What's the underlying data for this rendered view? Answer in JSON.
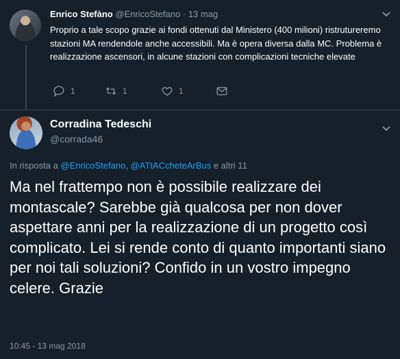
{
  "parent": {
    "display_name": "Enrico Stefàno",
    "handle": "@EnricoStefano",
    "separator": "·",
    "time": "13 mag",
    "text": "Proprio a tale scopo grazie ai fondi ottenuti dal Ministero (400 milioni) ristrutureremo stazioni MA rendendole anche accessibili. Ma è opera diversa dalla MC. Problema è realizzazione ascensori, in alcune stazioni con complicazioni tecniche elevate",
    "replies": "1",
    "retweets": "1",
    "likes": "1"
  },
  "tweet": {
    "display_name": "Corradina Tedeschi",
    "handle": "@corrada46",
    "reply_prefix": "In risposta a",
    "reply_mention_1": "@EnricoStefano",
    "reply_comma": ",",
    "reply_mention_2": "@ATtACcheteArBus",
    "reply_suffix": "e altri 11",
    "text": "Ma nel frattempo non è possibile realizzare dei montascale? Sarebbe già qualcosa per non dover aspettare anni per la realizzazione di un progetto così complicato. Lei si rende conto di quanto importanti siano per noi tali soluzioni? Confido in un vostro impegno celere. Grazie",
    "timestamp": "10:45 - 13 mag 2018"
  },
  "icons": {
    "reply": "reply-icon",
    "retweet": "retweet-icon",
    "like": "heart-icon",
    "dm": "envelope-icon",
    "more": "chevron-down-icon"
  },
  "colors": {
    "background": "#15202b",
    "secondary_text": "#8899a6",
    "link": "#1da1f2",
    "divider": "#38444d"
  }
}
